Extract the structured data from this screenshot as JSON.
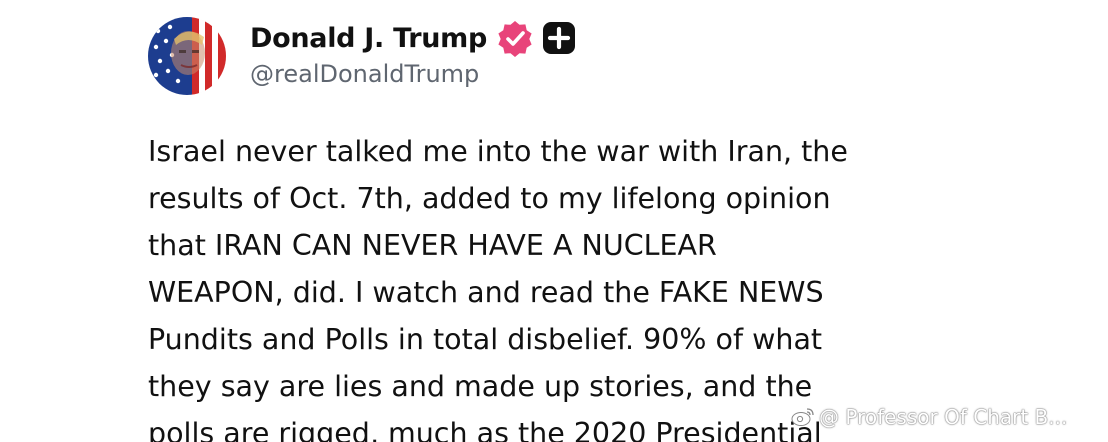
{
  "post": {
    "author": {
      "display_name": "Donald J. Trump",
      "handle": "@realDonaldTrump",
      "avatar_icon": "flag-portrait-avatar",
      "verified_icon": "verified-badge-icon",
      "extra_badge_icon": "plus-badge-icon"
    },
    "body": "Israel never talked me into the war with Iran, the\nresults of Oct. 7th, added to my lifelong opinion\nthat IRAN CAN NEVER HAVE A NUCLEAR\nWEAPON, did. I watch and read the FAKE NEWS\nPundits and Polls in total disbelief. 90% of what\nthey say are lies and made up stories, and the\npolls are rigged, much as the 2020 Presidential"
  },
  "watermark": {
    "text": "@ Professor Of Chart B...",
    "icon": "weibo-icon"
  },
  "colors": {
    "text": "#111111",
    "handle": "#5f6670",
    "verified_badge": "#e8447a",
    "plus_badge": "#111111",
    "background": "#ffffff"
  }
}
